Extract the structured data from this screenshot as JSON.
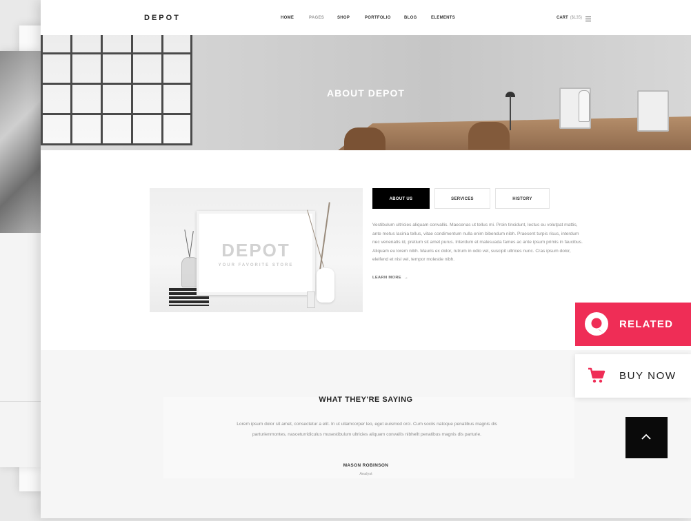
{
  "header": {
    "logo": "DEPOT",
    "menu": [
      "HOME",
      "PAGES",
      "SHOP",
      "PORTFOLIO",
      "BLOG",
      "ELEMENTS"
    ],
    "cart_label": "CART",
    "cart_amount": "($135)"
  },
  "hero": {
    "title": "ABOUT DEPOT"
  },
  "about": {
    "image_logo": "DEPOT",
    "image_tagline": "YOUR FAVORITE STORE",
    "tabs": [
      "ABOUT US",
      "SERVICES",
      "HISTORY"
    ],
    "active_tab": "ABOUT US",
    "text": "Vestibulum ultricies aliquam convallis. Maecenas ut tellus mi. Proin tincidunt, lectus eu volutpat mattis, ante metus lacinia tellus, vitae condimentum nulla enim bibendum nibh. Praesent turpis risus, interdum nec venenatis id, pretium sit amet purus. Interdum et malesuada fames ac ante ipsum primis in faucibus. Aliquam eu lorem nibh. Mauris ex dolor, rutrum in odio vel, suscipit ultrices nunc. Cras ipsum dolor, eleifend et nisl vel, tempor molestie nibh.",
    "learn_more": "LEARN MORE"
  },
  "testimonial": {
    "title": "WHAT THEY'RE SAYING",
    "text": "Lorem ipsum dolor sit amet, consectetur a elit. In ut ullamcorper leo, eget euismod orci. Cum sociis natoque penatibus magnis dis parturienmontes, nasceturridiculus musestibulum ultricies aliquam convallis nibhellt penatibus magnis dis parturie.",
    "name": "MASON ROBINSON",
    "role": "Analyst"
  },
  "widgets": {
    "related_label": "RELATED",
    "buy_now_label": "BUY NOW",
    "accent_color": "#ef2d56",
    "back_to_top_icon": "chevron-up-icon"
  }
}
